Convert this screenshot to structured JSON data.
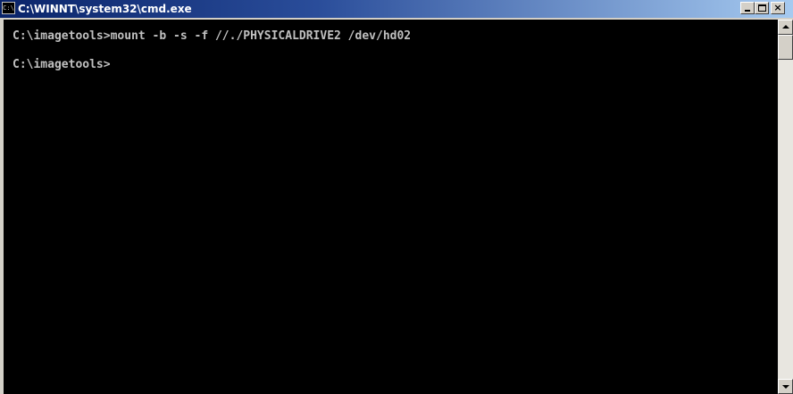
{
  "window": {
    "title": "C:\\WINNT\\system32\\cmd.exe",
    "icon": "cmd-prompt-icon",
    "icon_text": "C:\\",
    "buttons": {
      "minimize": "minimize-icon",
      "maximize": "maximize-icon",
      "close": "close-icon",
      "close_glyph": "×"
    }
  },
  "console": {
    "background": "#000000",
    "text_color": "#c0c0c0",
    "lines": [
      "C:\\imagetools>mount -b -s -f //./PHYSICALDRIVE2 /dev/hd02",
      "C:\\imagetools>"
    ]
  },
  "scrollbar": {
    "up": "scroll-up-arrow-icon",
    "down": "scroll-down-arrow-icon"
  }
}
